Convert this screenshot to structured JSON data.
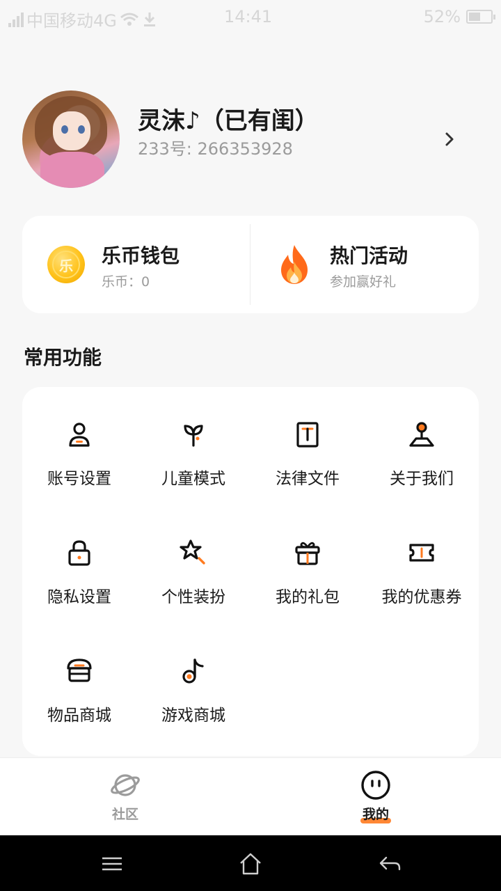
{
  "status_bar": {
    "carrier": "中国移动4G",
    "time": "14:41",
    "battery": "52%",
    "battery_level": 0.52
  },
  "profile": {
    "name": "灵沫♪（已有闺）",
    "uid": "233号: 266353928"
  },
  "cards": {
    "wallet": {
      "title": "乐币钱包",
      "sub": "乐币：0",
      "coin_char": "乐"
    },
    "activity": {
      "title": "热门活动",
      "sub": "参加赢好礼"
    }
  },
  "section": {
    "title": "常用功能"
  },
  "functions": [
    {
      "label": "账号设置",
      "icon": "account-icon"
    },
    {
      "label": "儿童模式",
      "icon": "child-mode-icon"
    },
    {
      "label": "法律文件",
      "icon": "legal-doc-icon"
    },
    {
      "label": "关于我们",
      "icon": "about-us-icon"
    },
    {
      "label": "隐私设置",
      "icon": "lock-icon"
    },
    {
      "label": "个性装扮",
      "icon": "decoration-icon"
    },
    {
      "label": "我的礼包",
      "icon": "gift-icon"
    },
    {
      "label": "我的优惠券",
      "icon": "coupon-icon"
    },
    {
      "label": "物品商城",
      "icon": "shop-icon"
    },
    {
      "label": "游戏商城",
      "icon": "game-store-icon"
    }
  ],
  "bottom_nav": {
    "community": "社区",
    "mine": "我的"
  },
  "colors": {
    "accent": "#ff7a1f",
    "text": "#1a1a1a",
    "muted": "#9b9b9b",
    "background": "#f7f7f7"
  }
}
